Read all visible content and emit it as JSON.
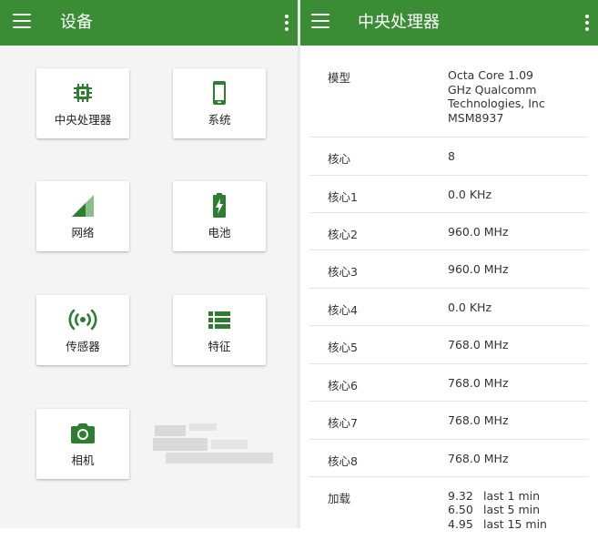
{
  "left": {
    "title": "设备",
    "cards": [
      {
        "label": "中央处理器",
        "icon": "cpu-chip-icon"
      },
      {
        "label": "系统",
        "icon": "smartphone-icon"
      },
      {
        "label": "网络",
        "icon": "cellular-signal-icon"
      },
      {
        "label": "电池",
        "icon": "battery-charging-icon"
      },
      {
        "label": "传感器",
        "icon": "sensor-waves-icon"
      },
      {
        "label": "特征",
        "icon": "list-icon"
      },
      {
        "label": "相机",
        "icon": "camera-icon"
      }
    ]
  },
  "right": {
    "title": "中央处理器",
    "rows": [
      {
        "key": "模型",
        "value": "Octa Core 1.09 GHz Qualcomm Technologies, Inc MSM8937"
      },
      {
        "key": "核心",
        "value": "8"
      },
      {
        "key": "核心1",
        "value": "0.0 KHz"
      },
      {
        "key": "核心2",
        "value": "960.0 MHz"
      },
      {
        "key": "核心3",
        "value": "960.0 MHz"
      },
      {
        "key": "核心4",
        "value": "0.0 KHz"
      },
      {
        "key": "核心5",
        "value": "768.0 MHz"
      },
      {
        "key": "核心6",
        "value": "768.0 MHz"
      },
      {
        "key": "核心7",
        "value": "768.0 MHz"
      },
      {
        "key": "核心8",
        "value": "768.0 MHz"
      }
    ],
    "load": {
      "key": "加载",
      "items": [
        {
          "value": "9.32",
          "period": "last 1 min"
        },
        {
          "value": "6.50",
          "period": "last 5 min"
        },
        {
          "value": "4.95",
          "period": "last 15 min"
        }
      ]
    }
  },
  "colors": {
    "accent": "#3a8c35",
    "icon": "#2e7d32"
  }
}
